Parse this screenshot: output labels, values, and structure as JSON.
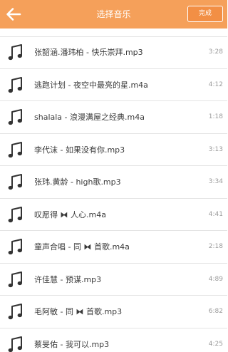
{
  "header": {
    "title": "选择音乐",
    "done_label": "完成"
  },
  "icons": {
    "back": "arrow-left-icon",
    "song": "music-note-icon"
  },
  "colors": {
    "header_bg": "#f5a05a",
    "done_bg": "#f28f45"
  },
  "songs": [
    {
      "name": "张韶涵.潘玮柏 - 快乐崇拜.mp3",
      "duration": "3:28"
    },
    {
      "name": "逃跑计划 - 夜空中最亮的星.m4a",
      "duration": "4:12"
    },
    {
      "name": "shalala - 浪漫满屋之经典.m4a",
      "duration": "1:18"
    },
    {
      "name": "李代沫 - 如果没有你.mp3",
      "duration": "3:13"
    },
    {
      "name": "张玮.黄龄 - high歌.mp3",
      "duration": "3:34"
    },
    {
      "name": "叹愿得 ⧓ 人心.m4a",
      "duration": "4:41"
    },
    {
      "name": "童声合唱 - 同 ⧓ 首歌.m4a",
      "duration": "2:18"
    },
    {
      "name": "许佳慧 - 预谋.mp3",
      "duration": "4:89"
    },
    {
      "name": "毛阿敏 - 同 ⧓ 首歌.mp3",
      "duration": "6:82"
    },
    {
      "name": "蔡旻佑 - 我可以.mp3",
      "duration": "4:25"
    }
  ]
}
